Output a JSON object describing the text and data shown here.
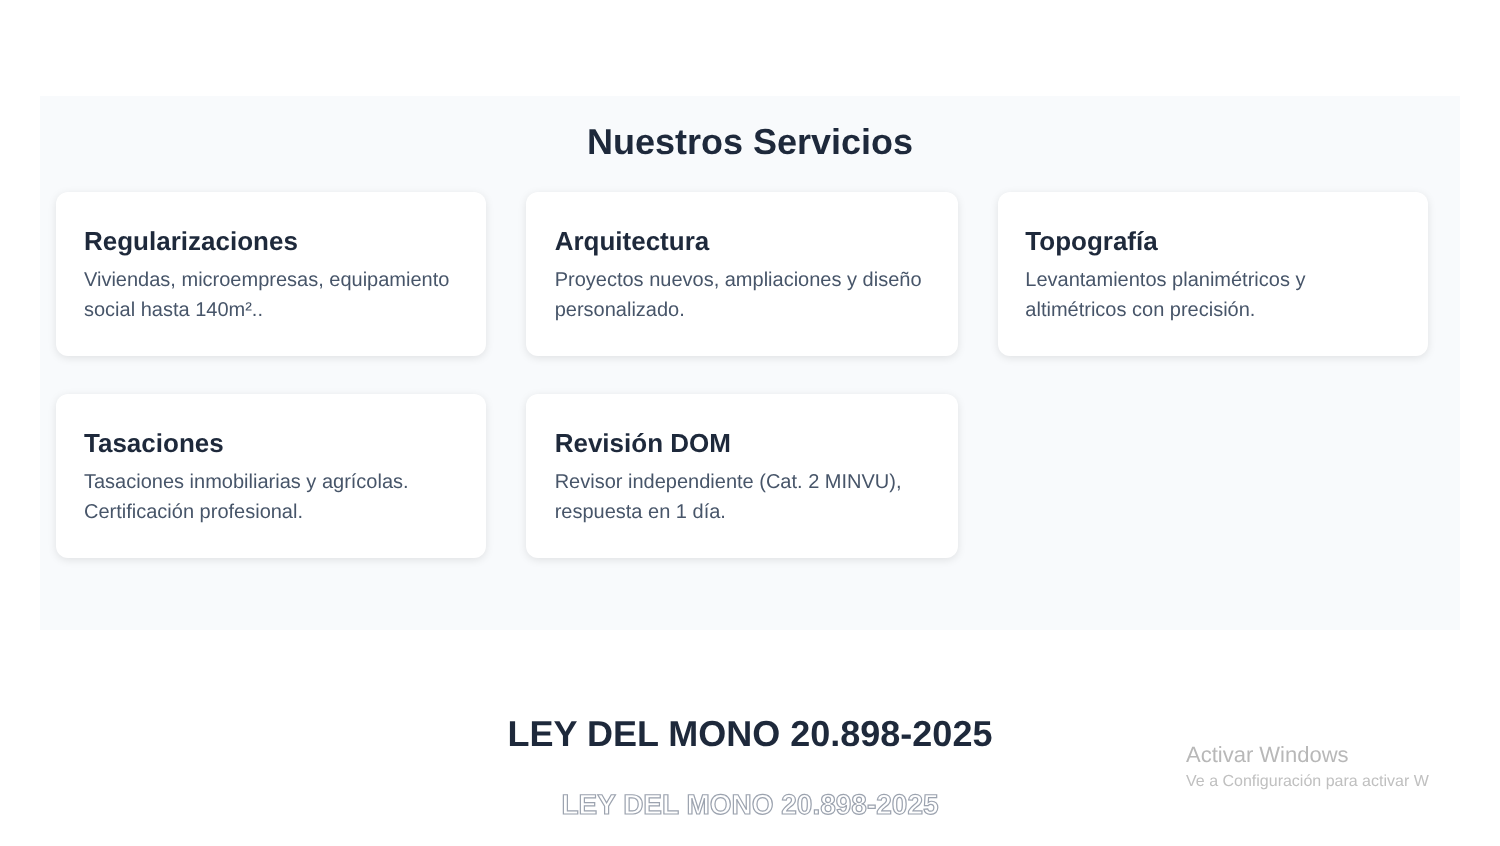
{
  "services": {
    "title": "Nuestros Servicios",
    "cards": [
      {
        "title": "Regularizaciones",
        "text": "Viviendas, microempresas, equipamiento social hasta 140m².."
      },
      {
        "title": "Arquitectura",
        "text": "Proyectos nuevos, ampliaciones y diseño personalizado."
      },
      {
        "title": "Topografía",
        "text": "Levantamientos planimétricos y altimétricos con precisión."
      },
      {
        "title": "Tasaciones",
        "text": "Tasaciones inmobiliarias y agrícolas. Certificación profesional."
      },
      {
        "title": "Revisión DOM",
        "text": "Revisor independiente (Cat. 2 MINVU), respuesta en 1 día."
      }
    ]
  },
  "law": {
    "heading": "LEY DEL MONO 20.898-2025",
    "outlined_text": "LEY DEL MONO 20.898-2025"
  },
  "activation_notice": {
    "title": "Activar Windows",
    "text": "Ve a Configuración para activar W"
  }
}
